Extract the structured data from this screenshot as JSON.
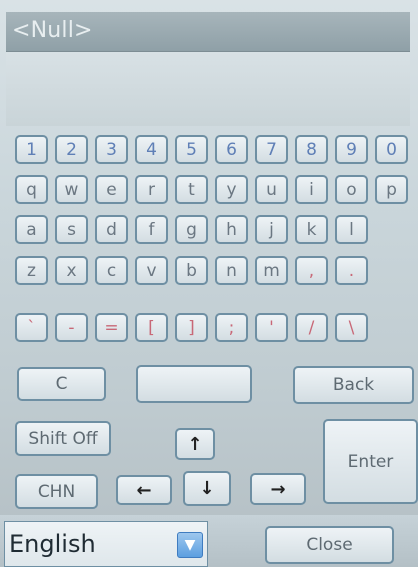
{
  "title": "<Null>",
  "keys": {
    "numbers": [
      "1",
      "2",
      "3",
      "4",
      "5",
      "6",
      "7",
      "8",
      "9",
      "0"
    ],
    "row2": [
      "q",
      "w",
      "e",
      "r",
      "t",
      "y",
      "u",
      "i",
      "o",
      "p"
    ],
    "row3": [
      "a",
      "s",
      "d",
      "f",
      "g",
      "h",
      "j",
      "k",
      "l"
    ],
    "row4": [
      "z",
      "x",
      "c",
      "v",
      "b",
      "n",
      "m",
      ",",
      "."
    ],
    "row5": [
      "`",
      "-",
      "=",
      "[",
      "]",
      ";",
      "'",
      "/",
      "\\"
    ]
  },
  "actions": {
    "clear_label": "C",
    "space_label": "",
    "back_label": "Back",
    "shift_label": "Shift Off",
    "enter_label": "Enter",
    "chn_label": "CHN",
    "close_label": "Close",
    "up_arrow": "↑",
    "down_arrow": "↓",
    "left_arrow": "←",
    "right_arrow": "→"
  },
  "language": {
    "selected": "English",
    "dropdown_icon": "chevron-down-icon"
  }
}
